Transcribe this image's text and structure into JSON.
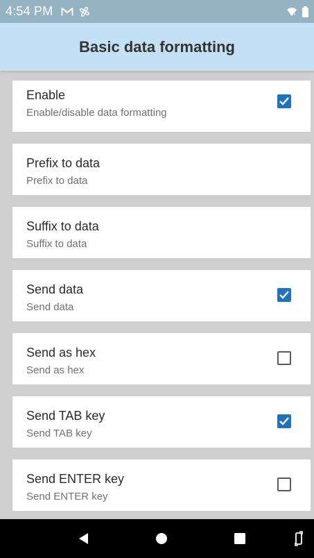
{
  "status_bar": {
    "time": "4:54 PM",
    "icons": [
      "gmail-icon",
      "pinwheel-icon",
      "wifi-icon",
      "battery-icon"
    ]
  },
  "app_bar": {
    "title": "Basic data formatting",
    "background": "#c4e0f5"
  },
  "settings": [
    {
      "title": "Enable",
      "subtitle": "Enable/disable data formatting",
      "has_checkbox": true,
      "checked": true
    },
    {
      "title": "Prefix to data",
      "subtitle": "Prefix to data",
      "has_checkbox": false
    },
    {
      "title": "Suffix to data",
      "subtitle": "Suffix to data",
      "has_checkbox": false
    },
    {
      "title": "Send data",
      "subtitle": "Send data",
      "has_checkbox": true,
      "checked": true
    },
    {
      "title": "Send as hex",
      "subtitle": "Send as hex",
      "has_checkbox": true,
      "checked": false
    },
    {
      "title": "Send TAB key",
      "subtitle": "Send TAB key",
      "has_checkbox": true,
      "checked": true
    },
    {
      "title": "Send ENTER key",
      "subtitle": "Send ENTER key",
      "has_checkbox": true,
      "checked": false
    }
  ],
  "nav_bar": {
    "buttons": [
      "back-icon",
      "home-icon",
      "recents-icon",
      "rotate-icon"
    ]
  },
  "colors": {
    "accent": "#1e73be",
    "status_bar": "#96b3c4",
    "list_background": "#cfcfcf"
  }
}
